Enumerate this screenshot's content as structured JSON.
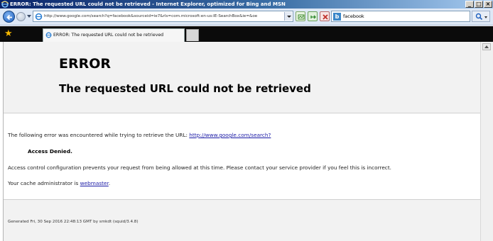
{
  "window": {
    "title": "ERROR: The requested URL could not be retrieved - Internet Explorer, optimized for Bing and MSN",
    "minimize_glyph": "_",
    "maximize_glyph": "□",
    "close_glyph": "×"
  },
  "toolbar": {
    "address_value": "http://www.google.com/search?q=facebook&sourceid=ie7&rls=com.microsoft:en-us:IE-SearchBox&ie=&oe",
    "search_value": "facebook",
    "search_provider_icon": "b"
  },
  "tabs": [
    {
      "label": "ERROR: The requested URL could not be retrieved"
    }
  ],
  "page": {
    "error_title": "ERROR",
    "error_subtitle": "The requested URL could not be retrieved",
    "intro_text": "The following error was encountered while trying to retrieve the URL: ",
    "intro_link": "http://www.google.com/search?",
    "denied_text": "Access Denied.",
    "explanation": "Access control configuration prevents your request from being allowed at this time. Please contact your service provider if you feel this is incorrect.",
    "admin_text": "Your cache administrator is ",
    "admin_link": "webmaster",
    "admin_suffix": ".",
    "footer": "Generated Fri, 30 Sep 2016 22:48:13 GMT by smkdt (squid/3.4.8)"
  },
  "icons": {
    "favorites": "★"
  },
  "colors": {
    "titlebar_start": "#0a246a",
    "link": "#1a1aa6",
    "header_bg": "#f2f2f2"
  }
}
